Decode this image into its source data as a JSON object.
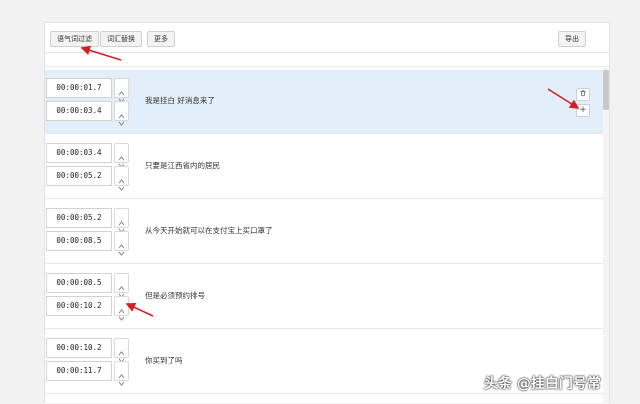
{
  "toolbar": {
    "filter_label": "语气词过滤",
    "replace_label": "词汇替换",
    "more_label": "更多",
    "export_label": "导出"
  },
  "rows": [
    {
      "start": "00:00:01.7",
      "end": "00:00:03.4",
      "text": "我是挂白 好消息来了",
      "active": true
    },
    {
      "start": "00:00:03.4",
      "end": "00:00:05.2",
      "text": "只要是江西省内的居民"
    },
    {
      "start": "00:00:05.2",
      "end": "00:00:08.5",
      "text": "从今天开始就可以在支付宝上买口罩了"
    },
    {
      "start": "00:00:08.5",
      "end": "00:00:10.2",
      "text": "但是必须预约排号"
    },
    {
      "start": "00:00:10.2",
      "end": "00:00:11.7",
      "text": "你买到了吗"
    }
  ],
  "icons": {
    "delete": "trash-icon",
    "add": "plus-icon",
    "spin_up": "chevron-up-icon",
    "spin_down": "chevron-down-icon"
  },
  "colors": {
    "active_row": "#e3eefb",
    "annotation_arrow": "#d42020"
  },
  "watermark": "头条 @挂白门号常"
}
